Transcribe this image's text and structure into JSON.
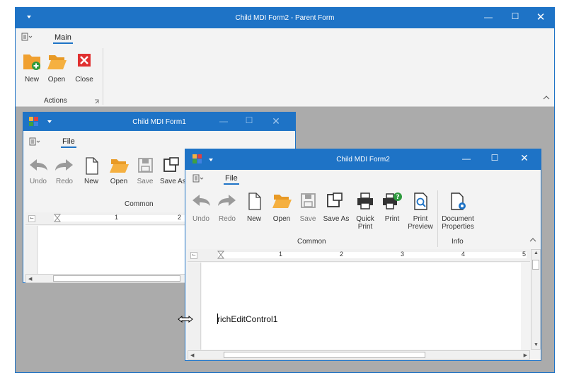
{
  "parent": {
    "title": "Child MDI Form2 - Parent Form",
    "tab_main": "Main",
    "actions": {
      "new": "New",
      "open": "Open",
      "close": "Close"
    },
    "group_label": "Actions"
  },
  "child1": {
    "title": "Child MDI Form1",
    "tab_file": "File",
    "buttons": {
      "undo": "Undo",
      "redo": "Redo",
      "new": "New",
      "open": "Open",
      "save": "Save",
      "save_as": "Save As"
    },
    "group_common": "Common",
    "ruler_marks": [
      "1",
      "2"
    ]
  },
  "child2": {
    "title": "Child MDI Form2",
    "tab_file": "File",
    "buttons": {
      "undo": "Undo",
      "redo": "Redo",
      "new": "New",
      "open": "Open",
      "save": "Save",
      "save_as": "Save As",
      "quick_print_1": "Quick",
      "quick_print_2": "Print",
      "print": "Print",
      "print_preview_1": "Print",
      "print_preview_2": "Preview",
      "doc_props_1": "Document",
      "doc_props_2": "Properties"
    },
    "group_common": "Common",
    "group_info": "Info",
    "ruler_marks": [
      "1",
      "2",
      "3",
      "4",
      "5"
    ],
    "editor_text": "richEditControl1"
  },
  "colors": {
    "accent": "#1e73c6",
    "mdi_bg": "#ababab",
    "orange": "#f0a030",
    "red": "#e03030"
  }
}
